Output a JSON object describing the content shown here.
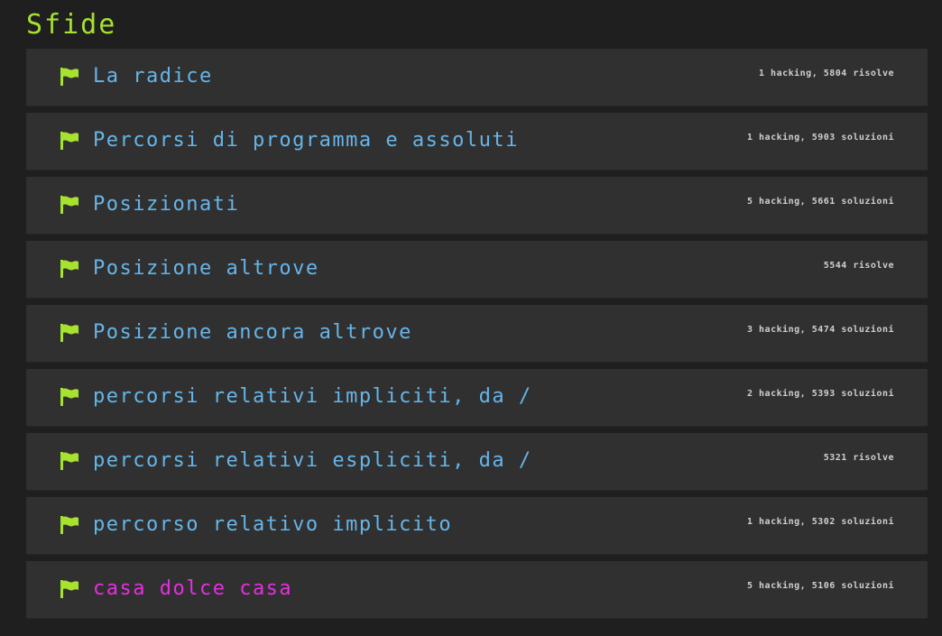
{
  "page": {
    "title": "Sfide"
  },
  "colors": {
    "title": "#a6e22e",
    "flag": "#a6e22e",
    "link": "#66b5e9",
    "link_active": "#e62ee0",
    "meta": "#cfcfcf",
    "background": "#1f1f1f",
    "card": "#303030"
  },
  "challenges": [
    {
      "title": "La radice",
      "meta": "1 hacking, 5804 risolve",
      "icon": "flag-icon",
      "active": false
    },
    {
      "title": "Percorsi di programma e assoluti",
      "meta": "1 hacking, 5903 soluzioni",
      "icon": "flag-icon",
      "active": false
    },
    {
      "title": "Posizionati",
      "meta": "5 hacking, 5661 soluzioni",
      "icon": "flag-icon",
      "active": false
    },
    {
      "title": "Posizione altrove",
      "meta": "5544 risolve",
      "icon": "flag-icon",
      "active": false
    },
    {
      "title": "Posizione ancora altrove",
      "meta": "3 hacking, 5474 soluzioni",
      "icon": "flag-icon",
      "active": false
    },
    {
      "title": "percorsi relativi impliciti, da /",
      "meta": "2 hacking, 5393 soluzioni",
      "icon": "flag-icon",
      "active": false
    },
    {
      "title": "percorsi relativi espliciti, da /",
      "meta": "5321 risolve",
      "icon": "flag-icon",
      "active": false
    },
    {
      "title": "percorso relativo implicito",
      "meta": "1 hacking, 5302 soluzioni",
      "icon": "flag-icon",
      "active": false
    },
    {
      "title": "casa dolce casa",
      "meta": "5 hacking, 5106 soluzioni",
      "icon": "flag-icon",
      "active": true
    }
  ]
}
